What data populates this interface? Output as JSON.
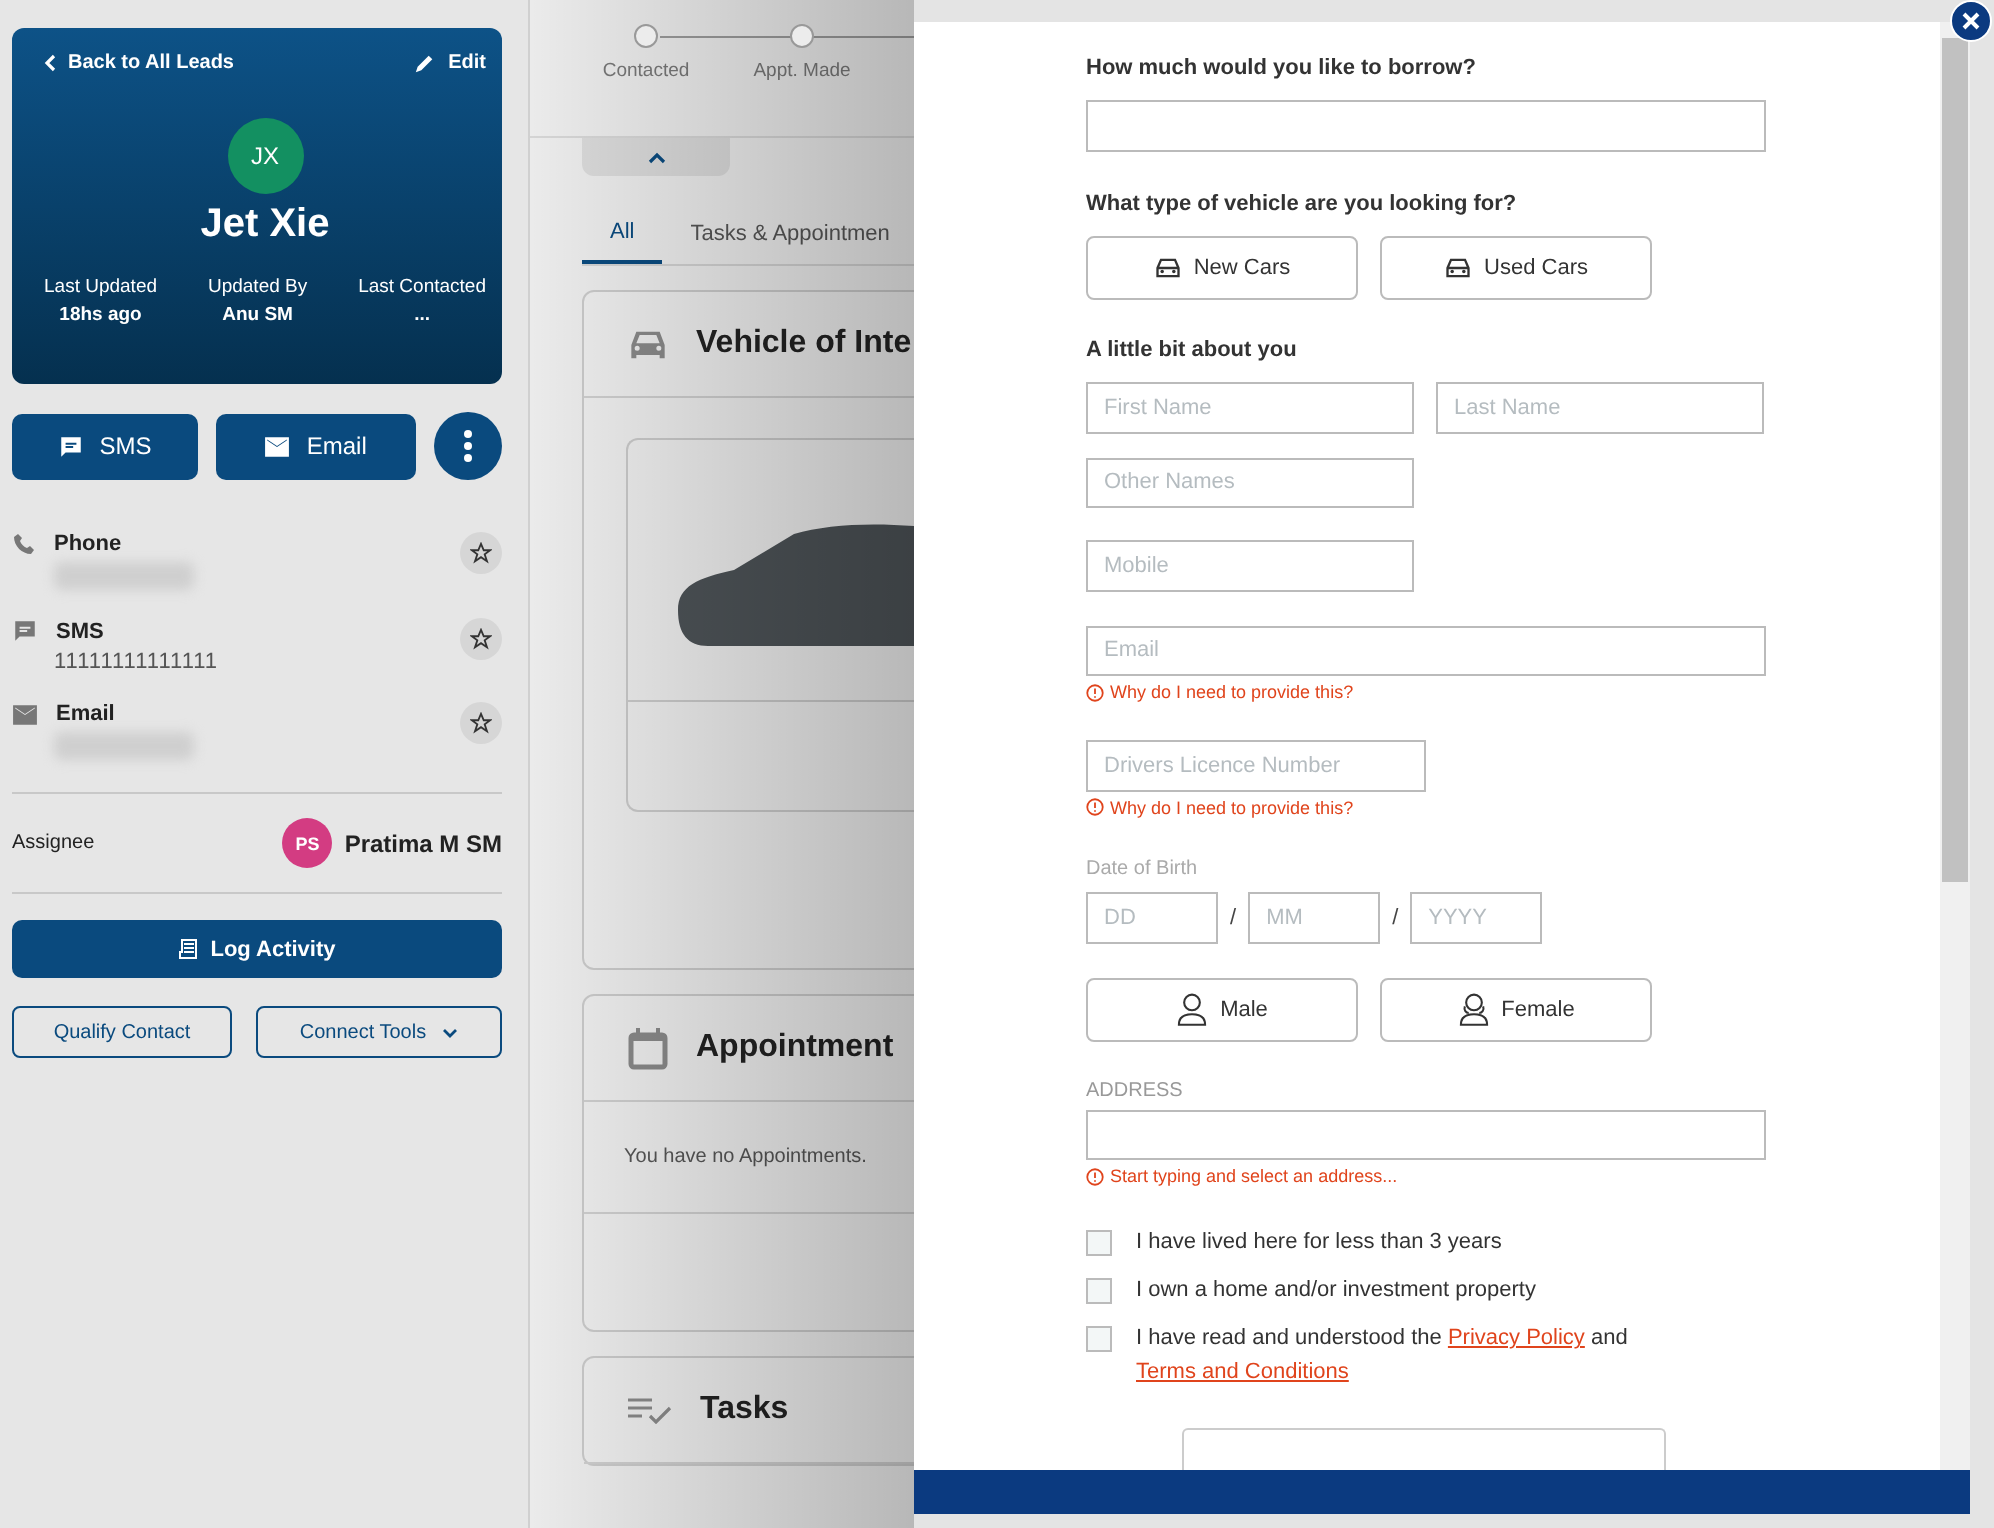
{
  "lead": {
    "back_label": "Back to All Leads",
    "edit_label": "Edit",
    "initials": "JX",
    "name": "Jet Xie",
    "stats": [
      {
        "label": "Last Updated",
        "value": "18hs ago"
      },
      {
        "label": "Updated By",
        "value": "Anu SM"
      },
      {
        "label": "Last Contacted",
        "value": "..."
      }
    ]
  },
  "actions": [
    {
      "kind": "sms",
      "label": "SMS"
    },
    {
      "kind": "email",
      "label": "Email"
    }
  ],
  "contacts": [
    {
      "kind": "phone",
      "label": "Phone",
      "blurred": true
    },
    {
      "kind": "sms",
      "label": "SMS",
      "value": "11111111111111",
      "blurred": false
    },
    {
      "kind": "email",
      "label": "Email",
      "blurred": true
    }
  ],
  "assignee": {
    "label": "Assignee",
    "initials": "PS",
    "name": "Pratima M SM"
  },
  "log_activity": "Log Activity",
  "qualify_contact": "Qualify Contact",
  "connect_tools": "Connect Tools",
  "stepper": [
    "Contacted",
    "Appt. Made"
  ],
  "tabs": [
    {
      "label": "All",
      "selected": true
    },
    {
      "label": "Tasks & Appointmen",
      "selected": false
    }
  ],
  "cards": [
    {
      "kind": "vehicle",
      "title": "Vehicle of Inte"
    },
    {
      "kind": "appointments",
      "title": "Appointment",
      "body": "You have no Appointments."
    },
    {
      "kind": "tasks",
      "title": "Tasks"
    }
  ],
  "form": {
    "borrow_label": "How much would you like to borrow?",
    "vehicle_question": "What type of vehicle are you looking for?",
    "vehicle_options": [
      {
        "label": "New Cars",
        "selected": false
      },
      {
        "label": "Used Cars",
        "selected": false
      }
    ],
    "about_heading": "A little bit about you",
    "first_name": {
      "placeholder": "First Name"
    },
    "last_name": {
      "placeholder": "Last Name"
    },
    "other_names": {
      "placeholder": "Other Names"
    },
    "mobile": {
      "placeholder": "Mobile"
    },
    "email": {
      "placeholder": "Email"
    },
    "email_hint": "Why do I need to provide this?",
    "licence": {
      "placeholder": "Drivers Licence Number"
    },
    "licence_hint": "Why do I need to provide this?",
    "dob_label": "Date of Birth",
    "dob": [
      {
        "placeholder": "DD"
      },
      {
        "placeholder": "MM"
      },
      {
        "placeholder": "YYYY"
      }
    ],
    "dob_separator": "/",
    "gender_options": [
      {
        "kind": "male",
        "label": "Male",
        "selected": false
      },
      {
        "kind": "female",
        "label": "Female",
        "selected": false
      }
    ],
    "address_label": "ADDRESS",
    "address_hint": "Start typing and select an address...",
    "checkboxes": [
      {
        "checked": false,
        "parts": [
          {
            "text": "I have lived here for less than 3 years",
            "link": false
          }
        ]
      },
      {
        "checked": false,
        "parts": [
          {
            "text": "I own a home and/or investment property",
            "link": false
          }
        ]
      },
      {
        "checked": false,
        "parts": [
          {
            "text": "I have read and understood the ",
            "link": false
          },
          {
            "text": "Privacy Policy",
            "link": true
          },
          {
            "text": " and ",
            "link": false
          },
          {
            "text": "Terms and Conditions",
            "link": true
          }
        ]
      }
    ]
  }
}
